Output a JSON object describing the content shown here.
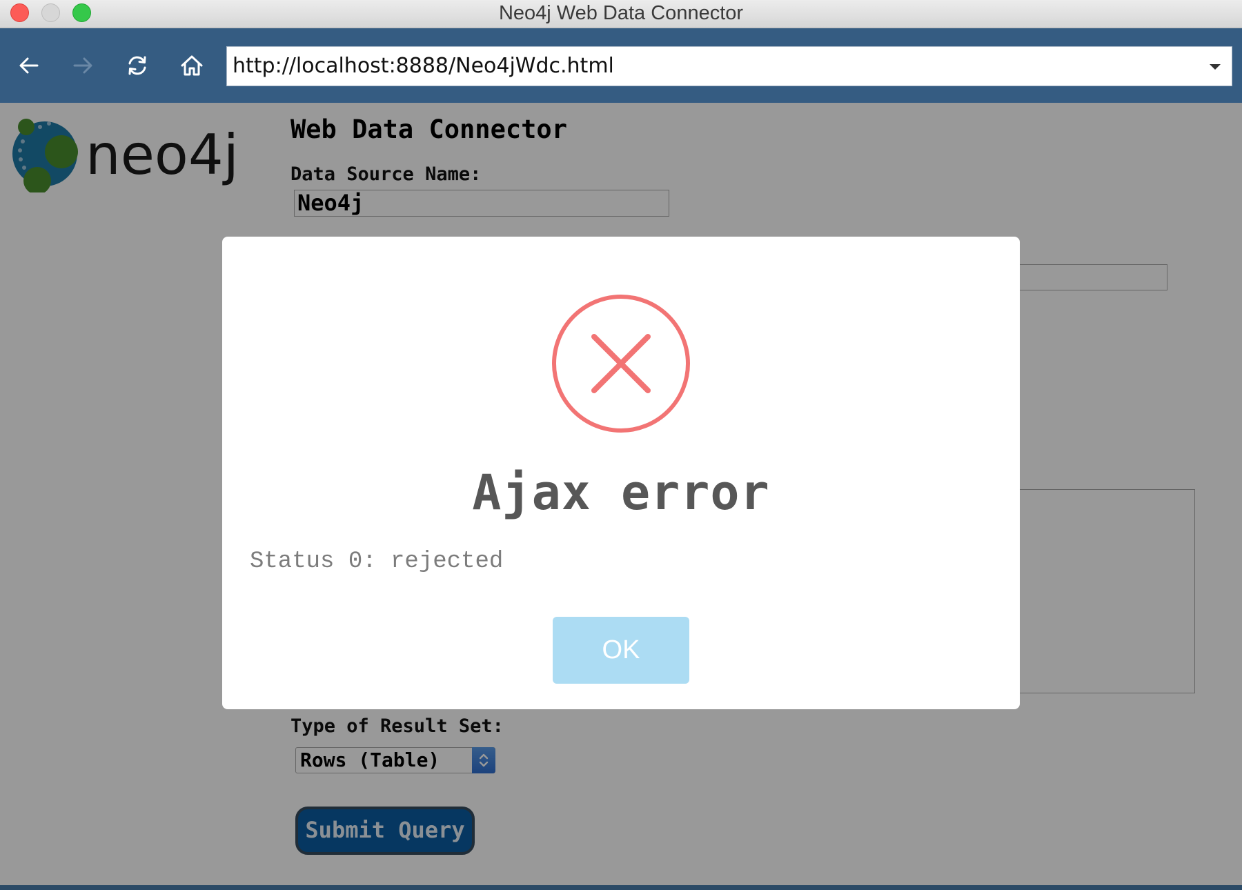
{
  "window": {
    "title": "Neo4j Web Data Connector"
  },
  "browser": {
    "url": "http://localhost:8888/Neo4jWdc.html"
  },
  "page": {
    "logo_text": "neo4j",
    "heading": "Web Data Connector",
    "data_source_label": "Data Source Name:",
    "data_source_value": "Neo4j",
    "result_set_label": "Type of Result Set:",
    "result_set_selected": "Rows (Table)",
    "submit_label": "Submit Query"
  },
  "modal": {
    "title": "Ajax error",
    "message": "Status 0: rejected",
    "ok_label": "OK",
    "icon": "error-x-icon",
    "icon_color": "#f27474"
  },
  "colors": {
    "toolbar": "#355c82",
    "submit_button": "#0a5da2",
    "ok_button": "#acdcf3"
  }
}
